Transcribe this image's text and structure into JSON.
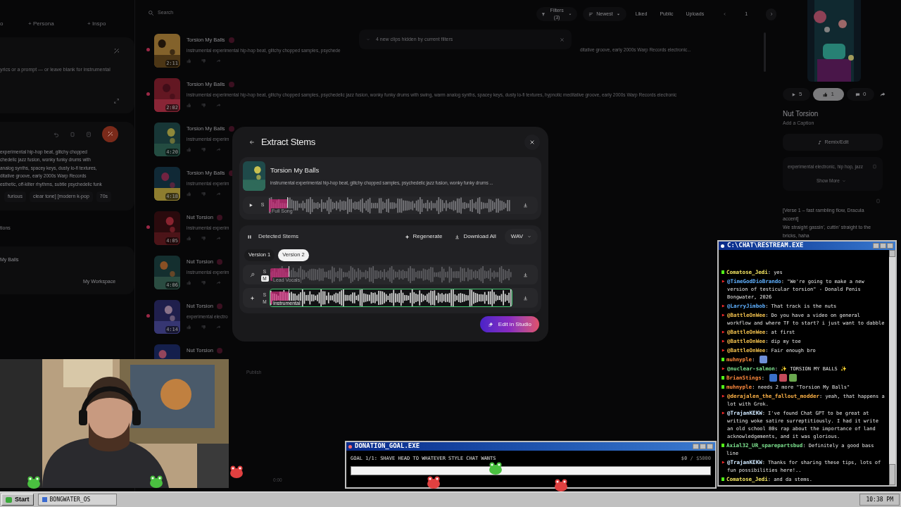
{
  "left_panel": {
    "tabs": [
      {
        "label": "o"
      },
      {
        "label": "+ Persona"
      },
      {
        "label": "+ Inspo"
      }
    ],
    "lyrics_field": {
      "placeholder": "yrics or a prompt — or leave blank for instrumental"
    },
    "style_lines": [
      "experimental hip-hop beat, glitchy chopped",
      "chedelic jazz fusion, wonky funky drums with",
      "analog synths, spacey keys, dusty lo-fi textures,",
      "ditative groove, early 2000s Warp Records",
      "esthetic, off-kilter rhythms, subtle psychedelic funk"
    ],
    "tags": [
      "furious",
      "clear tone] [modern k-pop",
      "70s"
    ],
    "section_label": "tions",
    "song_title": "My Balls",
    "workspace": "My Workspace"
  },
  "toolbar": {
    "search": {
      "placeholder": "Search"
    },
    "filters": "Filters (3)",
    "sort": "Newest",
    "chips": [
      "Liked",
      "Public",
      "Uploads"
    ],
    "page": "1"
  },
  "toast": "4 new clips hidden by current filters",
  "songs": [
    {
      "title": "Torsion My Balls",
      "duration": "2:11",
      "new": true,
      "description": "instrumental experimental hip-hop beat, glitchy chopped samples, psychede",
      "description_tail": "ditative groove, early 2000s Warp Records electronic..."
    },
    {
      "title": "Torsion My Balls",
      "duration": "2:02",
      "new": true,
      "description": "instrumental experimental hip-hop beat, glitchy chopped samples, psychedelic jazz fusion, wonky funky drums with swing, warm analog synths, spacey keys, dusty lo-fi textures, hypnotic meditative groove, early 2000s Warp Records electronic"
    },
    {
      "title": "Torsion My Balls",
      "duration": "4:20",
      "new": false,
      "description": "instrumental experim"
    },
    {
      "title": "Torsion My Balls",
      "duration": "4:18",
      "new": false,
      "description": "instrumental experim"
    },
    {
      "title": "Nut Torsion",
      "duration": "4:05",
      "new": true,
      "description": "instrumental experim"
    },
    {
      "title": "Nut Torsion",
      "duration": "4:06",
      "new": false,
      "description": "instrumental experim"
    },
    {
      "title": "Nut Torsion",
      "duration": "4:14",
      "new": true,
      "description": "experimental electro"
    },
    {
      "title": "Nut Torsion",
      "new": false
    }
  ],
  "publish": "Publish",
  "player_time": "0:00",
  "detail": {
    "plays": "5",
    "likes": "1",
    "liked": true,
    "comments": "0",
    "title": "Nut Torsion",
    "caption_placeholder": "Add a Caption",
    "remix": "Remix/Edit",
    "style": "experimental electronic, hip hop, jazz",
    "show_more": "Show More",
    "lyrics": [
      "[Verse 1 – fast rambling flow, Dracula accent]",
      "We straight gassin', cuttin' straight to the bricks, haha"
    ]
  },
  "modal": {
    "title": "Extract Stems",
    "song": {
      "title": "Torsion My Balls",
      "description": "instrumental experimental hip-hop beat, glitchy chopped samples, psychedelic jazz fusion, wonky funky drums ...",
      "track_label": "Full Song",
      "solo": "S",
      "level": 0.075
    },
    "stems_heading": "Detected Stems",
    "regenerate": "Regenerate",
    "download_all": "Download All",
    "format": "WAV",
    "versions": [
      {
        "label": "Version 1",
        "selected": false
      },
      {
        "label": "Version 2",
        "selected": true
      }
    ],
    "stems": [
      {
        "kind": "vocals",
        "label": "Lead Vocals",
        "solo": "S",
        "mute": "M",
        "muted": true,
        "selected": false,
        "level": 0.075
      },
      {
        "kind": "instrumental",
        "label": "Instrumental",
        "solo": "S",
        "mute": "M",
        "muted": false,
        "selected": true,
        "level": 0.075
      }
    ],
    "edit_button": "Edit in Studio"
  },
  "chat_window": {
    "title": "C:\\CHAT\\RESTREAM.EXE",
    "messages": [
      {
        "kind": "kick",
        "user": "Comatose_Jedi",
        "color": "#f5e663",
        "text": ": yes"
      },
      {
        "kind": "youtube",
        "user": "@TimeGodDioBrando",
        "color": "#5fb0ff",
        "text": ": \"We're going to make a new version of testicular torsion\" - Donald Penis Bongwater, 2026"
      },
      {
        "kind": "youtube",
        "user": "@LarryJimbob",
        "color": "#5fb0ff",
        "text": ": That track is the nuts"
      },
      {
        "kind": "youtube",
        "user": "@BattleOnWee",
        "color": "#f2c14e",
        "text": ": Do you have a video on general workflow and where TF to start? i just want to dabble"
      },
      {
        "kind": "youtube",
        "user": "@BattleOnWee",
        "color": "#f2c14e",
        "text": ": at first"
      },
      {
        "kind": "youtube",
        "user": "@BattleOnWee",
        "color": "#f2c14e",
        "text": ": dip my toe"
      },
      {
        "kind": "youtube",
        "user": "@BattleOnWee",
        "color": "#f2c14e",
        "text": ": Fair enough bro"
      },
      {
        "kind": "kick",
        "user": "muhnyple",
        "color": "#ff8a3d",
        "text": ":",
        "emotes": [
          {
            "color": "#6f8fd8"
          }
        ]
      },
      {
        "kind": "youtube",
        "user": "@nuclear-salmon",
        "color": "#7de38f",
        "text": ": ✨ TORSION MY BALLS ✨"
      },
      {
        "kind": "kick",
        "user": "BrianStings",
        "color": "#ff8a3d",
        "text": ":",
        "emotes": [
          {
            "color": "#3a6fc9"
          },
          {
            "color": "#c24a5a"
          },
          {
            "color": "#6aa84f"
          }
        ]
      },
      {
        "kind": "kick",
        "user": "muhnyple",
        "color": "#ff8a3d",
        "text": ": needs 2 more \"Torsion My Balls\""
      },
      {
        "kind": "youtube",
        "user": "@derajalen_the_fallout_modder",
        "color": "#ffb347",
        "text": ": yeah, that happens a lot with Grok."
      },
      {
        "kind": "youtube",
        "user": "@TrajanKEKW",
        "color": "#cfe8ff",
        "text": ": I've found Chat GPT to be great at writing woke satire surreptitiously. I had it write an old school 80s rap about the importance of land acknowledgements, and it was glorious."
      },
      {
        "kind": "kick",
        "user": "Axial32_UR_sparepartsbud",
        "color": "#7de38f",
        "text": ": Definitely a good bass line"
      },
      {
        "kind": "youtube",
        "user": "@TrajanKEKW",
        "color": "#cfe8ff",
        "text": ": Thanks for sharing these tips, lots of fun possibilities here!.."
      },
      {
        "kind": "kick",
        "user": "Comatose_Jedi",
        "color": "#f5e663",
        "text": ": and da stems."
      }
    ]
  },
  "donation_window": {
    "title": "DONATION_GOAL.EXE",
    "goal": "GOAL 1/1: SHAVE HEAD TO WHATEVER STYLE CHAT WANTS",
    "amount": "**$0** / $5000",
    "level": 0
  },
  "taskbar": {
    "start": "Start",
    "tasks": [
      "BONGWATER_OS"
    ],
    "clock": "10:38 PM"
  }
}
